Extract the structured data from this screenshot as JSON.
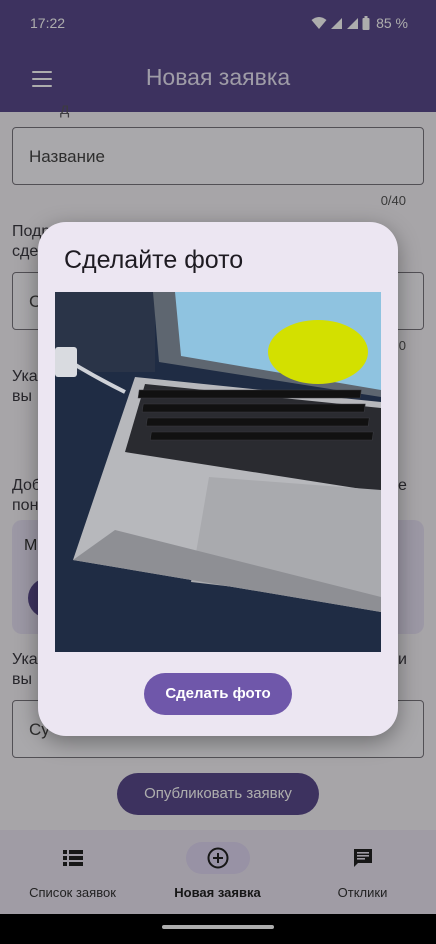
{
  "status": {
    "time": "17:22",
    "battery": "85 %"
  },
  "app_bar": {
    "title": "Новая заявка"
  },
  "form": {
    "name_label_fragment": "д",
    "name_placeholder": "Название",
    "name_counter": "0/40",
    "desc_label_fragment": "Подр\nсде",
    "desc_placeholder_fragment": "С",
    "desc_counter_fragment": "0",
    "date_label_fragment": "Ука\nвы",
    "photo_label_left": "Доб\nпон",
    "photo_label_right": "е",
    "card_text_fragment": "М",
    "price_label_left": "Ука\nвы",
    "price_label_right": "и",
    "price_placeholder_fragment": "Су",
    "publish_label": "Опубликовать заявку"
  },
  "dialog": {
    "title": "Сделайте фото",
    "take_photo_label": "Сделать фото"
  },
  "bottom_nav": {
    "items": [
      {
        "label": "Список заявок",
        "icon": "list-icon",
        "active": false
      },
      {
        "label": "Новая заявка",
        "icon": "add-circle-icon",
        "active": true
      },
      {
        "label": "Отклики",
        "icon": "message-icon",
        "active": false
      }
    ]
  },
  "colors": {
    "primary": "#5a4a8c",
    "dialog_button": "#6f57aa",
    "dialog_bg": "#ece6f2"
  }
}
